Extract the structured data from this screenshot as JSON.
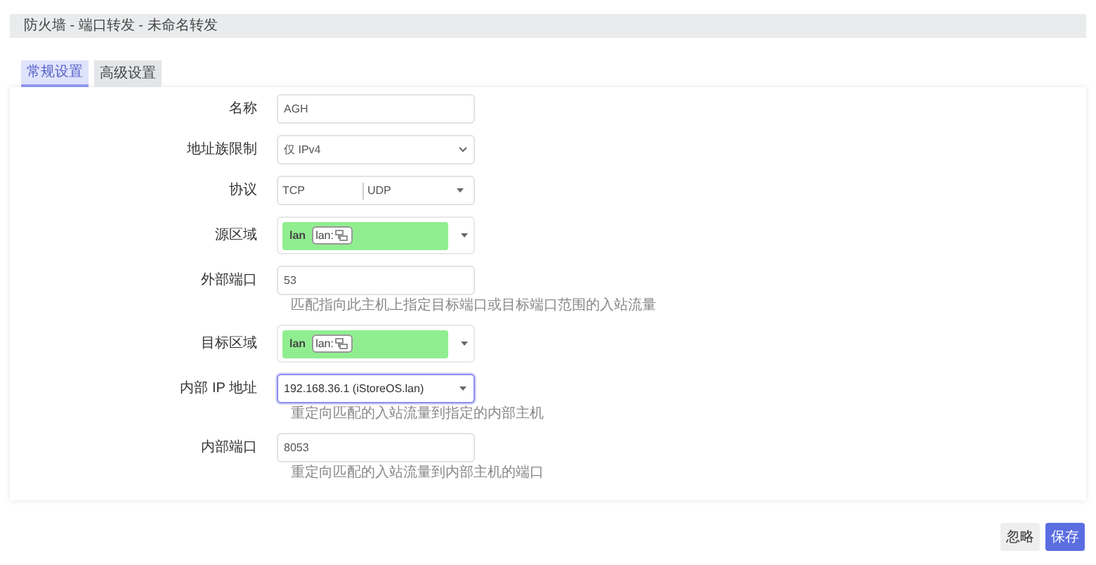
{
  "breadcrumb": "防火墙 - 端口转发 - 未命名转发",
  "tabs": [
    {
      "label": "常规设置",
      "selected": true
    },
    {
      "label": "高级设置",
      "selected": false
    }
  ],
  "fields": [
    {
      "kind": "text",
      "label": "名称",
      "value": "AGH"
    },
    {
      "kind": "select",
      "label": "地址族限制",
      "value": "仅 IPv4"
    },
    {
      "kind": "multi",
      "label": "协议",
      "values": [
        "TCP",
        "UDP"
      ]
    },
    {
      "kind": "zone",
      "label": "源区域",
      "zone": "lan",
      "tag": "lan:",
      "color": "#90ee90"
    },
    {
      "kind": "text",
      "label": "外部端口",
      "value": "53",
      "hint": "匹配指向此主机上指定目标端口或目标端口范围的入站流量"
    },
    {
      "kind": "zone",
      "label": "目标区域",
      "zone": "lan",
      "tag": "lan:",
      "color": "#90ee90"
    },
    {
      "kind": "combo",
      "label": "内部 IP 地址",
      "value": "192.168.36.1 (iStoreOS.lan)",
      "focused": true,
      "hint": "重定向匹配的入站流量到指定的内部主机"
    },
    {
      "kind": "text",
      "label": "内部端口",
      "value": "8053",
      "hint": "重定向匹配的入站流量到内部主机的端口"
    }
  ],
  "buttons": [
    {
      "label": "忽略",
      "kind": "secondary"
    },
    {
      "label": "保存",
      "kind": "primary"
    }
  ]
}
